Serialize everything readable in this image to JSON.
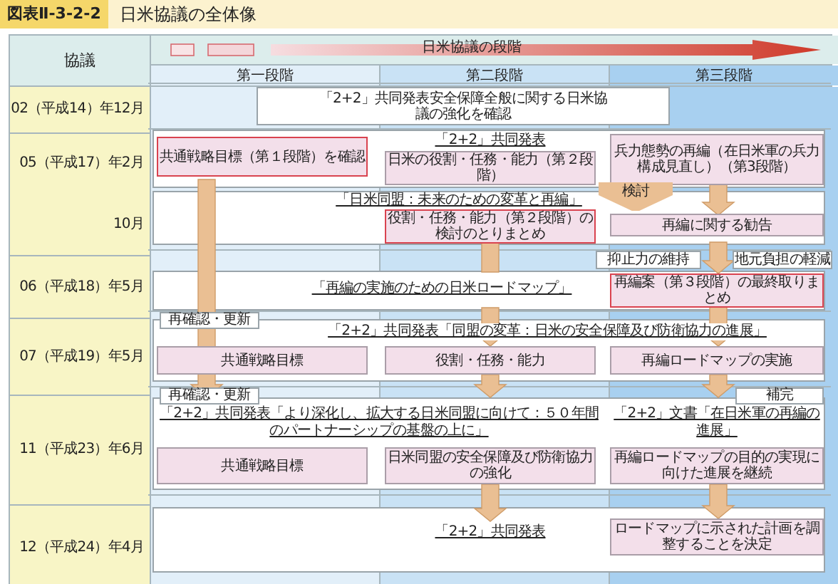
{
  "figure": {
    "number": "図表Ⅱ-3-2-2",
    "title": "日米協議の全体像"
  },
  "header": {
    "corner": "協議",
    "progress": "日米協議の段階",
    "stages": [
      "第一段階",
      "第二段階",
      "第三段階"
    ]
  },
  "timeline": [
    [
      "02（平成14）年12月"
    ],
    [
      "05（平成17）年2月",
      "10月"
    ],
    [
      "06（平成18）年5月"
    ],
    [
      "07（平成19）年5月"
    ],
    [
      "11（平成23）年6月"
    ],
    [
      "12（平成24）年4月"
    ]
  ],
  "events": [
    {
      "kind": "statement",
      "text": "「2+2」共同発表安全保障全般に関する日米協議の強化を確認"
    },
    {
      "kind": "item",
      "text": "共通戦略目標（第１段階）を確認",
      "highlighted": true
    },
    {
      "kind": "caption",
      "text": "「2+2」共同発表"
    },
    {
      "kind": "item",
      "text": "日米の役割・任務・能力（第２段階）",
      "highlighted": false
    },
    {
      "kind": "item",
      "text": "兵力態勢の再編（在日米軍の兵力構成見直し）（第3段階）",
      "highlighted": false
    },
    {
      "kind": "caption",
      "text": "「日米同盟：未来のための変革と再編」"
    },
    {
      "kind": "label",
      "text": "検討"
    },
    {
      "kind": "item",
      "text": "役割・任務・能力（第２段階）の検討のとりまとめ",
      "highlighted": true
    },
    {
      "kind": "item",
      "text": "再編に関する勧告",
      "highlighted": false
    },
    {
      "kind": "tag",
      "text": "抑止力の維持"
    },
    {
      "kind": "tag",
      "text": "地元負担の軽減"
    },
    {
      "kind": "caption",
      "text": "「再編の実施のための日米ロードマップ」"
    },
    {
      "kind": "item",
      "text": "再編案（第３段階）の最終取りまとめ",
      "highlighted": true
    },
    {
      "kind": "tag",
      "text": "再確認・更新"
    },
    {
      "kind": "caption",
      "text": "「2+2」共同発表「同盟の変革：日米の安全保障及び防衛協力の進展」"
    },
    {
      "kind": "item",
      "text": "共通戦略目標",
      "highlighted": false
    },
    {
      "kind": "item",
      "text": "役割・任務・能力",
      "highlighted": false
    },
    {
      "kind": "item",
      "text": "再編ロードマップの実施",
      "highlighted": false
    },
    {
      "kind": "tag",
      "text": "再確認・更新"
    },
    {
      "kind": "tag",
      "text": "補完"
    },
    {
      "kind": "caption",
      "text": "「2+2」共同発表「より深化し、拡大する日米同盟に向けて：５０年間のパートナーシップの基盤の上に」"
    },
    {
      "kind": "caption",
      "text": "「2+2」文書「在日米軍の再編の進展」"
    },
    {
      "kind": "item",
      "text": "共通戦略目標",
      "highlighted": false
    },
    {
      "kind": "item",
      "text": "日米同盟の安全保障及び防衛協力の強化",
      "highlighted": false
    },
    {
      "kind": "item",
      "text": "再編ロードマップの目的の実現に向けた進展を継続",
      "highlighted": false
    },
    {
      "kind": "caption",
      "text": "「2+2」共同発表"
    },
    {
      "kind": "item",
      "text": "ロードマップに示された計画を調整することを決定",
      "highlighted": false
    }
  ]
}
